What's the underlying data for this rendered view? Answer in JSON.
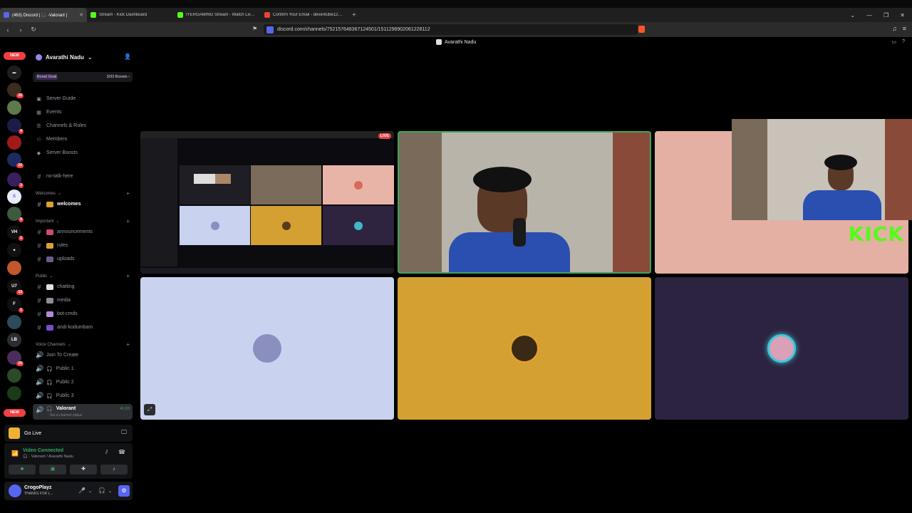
{
  "browser": {
    "tabs": [
      {
        "title": "(463) Discord | 🎧 -Valorant |",
        "color": "#5865f2",
        "active": true
      },
      {
        "title": "Stream - Kick Dashboard",
        "color": "#53fc18",
        "active": false
      },
      {
        "title": "IYERGAMING Stream - Watch Live on",
        "color": "#53fc18",
        "active": false
      },
      {
        "title": "Confirm Your Email - deventube123@",
        "color": "#ea4335",
        "active": false
      }
    ],
    "new_tab": "+",
    "url": "discord.com/channels/752157648367124501/1511296902061228112"
  },
  "discord": {
    "channel_title": "Avarathi Nadu",
    "server_name": "Avarathi Nadu",
    "boost": {
      "label": "Boost Goal",
      "value": "3/33 Boosts ›"
    },
    "nav": [
      {
        "label": "Server Guide",
        "icon": "⬚"
      },
      {
        "label": "Events",
        "icon": "▦"
      },
      {
        "label": "Channels & Roles",
        "icon": "☰"
      },
      {
        "label": "Members",
        "icon": "👥"
      },
      {
        "label": "Server Boosts",
        "icon": "◆"
      }
    ],
    "top_channel": "no-talk-here",
    "categories": {
      "welcomes": "Welcomes",
      "important": "Important",
      "public": "Public",
      "voice": "Voice Channels"
    },
    "channels": {
      "welcomes": "welcomes",
      "announcements": "announcements",
      "rules": "rules",
      "uploads": "uploads",
      "chatting": "chatting",
      "media": "media",
      "bot_cmds": "bot-cmds",
      "andi": "andi-kodumbam"
    },
    "voice": {
      "join": "Join To Create",
      "public1": "Public 1",
      "public2": "Public 2",
      "public3": "Public 3",
      "valorant": "Valorant",
      "timer": "41:03",
      "status_placeholder": "Set a channel status"
    },
    "go_live": "Go Live",
    "video_connected": "Video Connected",
    "video_sub": "🎧 · Valorant / Avarathi Nadu",
    "user": {
      "name": "CrogoPlayz",
      "status": "THANKS FOR L..."
    },
    "rail": {
      "new_label": "NEW",
      "badges": [
        "10",
        "4",
        "10",
        "3",
        "8",
        "1",
        "13",
        "1",
        "10"
      ],
      "lb": "LB",
      "vh": "VH"
    }
  },
  "stream": {
    "live_label": "LIVE",
    "kick_text": "KICK"
  }
}
